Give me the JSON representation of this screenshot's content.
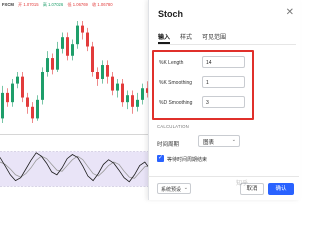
{
  "chart": {
    "symbol": "FXCM",
    "quotes": [
      "开 1.07015",
      "高 1.07026",
      "低 1.06769",
      "收 1.06780"
    ],
    "candles": [
      [
        30,
        52,
        26,
        58
      ],
      [
        52,
        44,
        40,
        56
      ],
      [
        44,
        60,
        40,
        64
      ],
      [
        60,
        66,
        56,
        70
      ],
      [
        66,
        48,
        44,
        70
      ],
      [
        48,
        40,
        34,
        52
      ],
      [
        40,
        30,
        26,
        44
      ],
      [
        30,
        46,
        28,
        50
      ],
      [
        46,
        70,
        42,
        74
      ],
      [
        70,
        82,
        66,
        88
      ],
      [
        82,
        72,
        68,
        86
      ],
      [
        72,
        90,
        70,
        96
      ],
      [
        90,
        100,
        86,
        104
      ],
      [
        100,
        84,
        80,
        104
      ],
      [
        84,
        94,
        80,
        98
      ],
      [
        94,
        110,
        90,
        114
      ],
      [
        110,
        104,
        98,
        114
      ],
      [
        104,
        92,
        88,
        108
      ],
      [
        92,
        70,
        66,
        96
      ],
      [
        70,
        64,
        58,
        74
      ],
      [
        64,
        76,
        60,
        80
      ],
      [
        76,
        66,
        60,
        80
      ],
      [
        66,
        54,
        50,
        70
      ],
      [
        54,
        60,
        48,
        64
      ],
      [
        60,
        44,
        40,
        64
      ],
      [
        44,
        50,
        38,
        54
      ],
      [
        50,
        40,
        34,
        54
      ],
      [
        40,
        46,
        36,
        52
      ],
      [
        46,
        56,
        42,
        60
      ],
      [
        56,
        52,
        48,
        62
      ]
    ],
    "osc_k": [
      70,
      55,
      40,
      30,
      35,
      50,
      65,
      78,
      72,
      60,
      45,
      40,
      52,
      68,
      75,
      70,
      55,
      38,
      30,
      42,
      58,
      66,
      60,
      48,
      35,
      28,
      40,
      56,
      62,
      50
    ],
    "osc_d": [
      62,
      58,
      50,
      40,
      36,
      42,
      52,
      65,
      72,
      68,
      58,
      48,
      46,
      56,
      66,
      72,
      66,
      54,
      42,
      38,
      46,
      56,
      62,
      58,
      46,
      36,
      34,
      44,
      54,
      56
    ]
  },
  "dialog": {
    "title": "Stoch",
    "tabs": [
      "输入",
      "样式",
      "可见范围"
    ],
    "fields": [
      {
        "label": "%K Length",
        "value": "14"
      },
      {
        "label": "%K Smoothing",
        "value": "1"
      },
      {
        "label": "%D Smoothing",
        "value": "3"
      }
    ],
    "calc_label": "CALCULATION",
    "timeframe_label": "时间周期",
    "timeframe_value": "图表",
    "gaps_label": "等待时间周期结束",
    "defaults_label": "系统预设",
    "cancel_label": "取消",
    "ok_label": "确认",
    "watermark": "知乎",
    "colors": {
      "accent": "#2962ff",
      "highlight": "#e0302b",
      "up": "#1e9e6a",
      "down": "#e23b3b"
    }
  }
}
